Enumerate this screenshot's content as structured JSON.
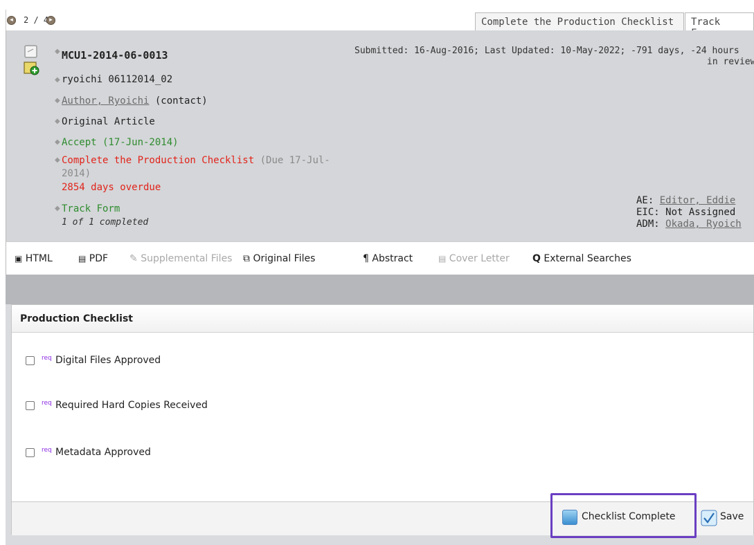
{
  "nav": {
    "pager_text": "2 / 4"
  },
  "tabs": [
    {
      "label": "Complete the Production Checklist"
    },
    {
      "label": "Track Form"
    }
  ],
  "manuscript": {
    "id": "MCU1-2014-06-0013",
    "title": "ryoichi 06112014_02",
    "author": "Author, Ryoichi",
    "author_suffix": "(contact)",
    "type": "Original Article",
    "decision": "Accept (17-Jun-2014)",
    "task": "Complete the Production Checklist",
    "task_due_1": "(Due 17-Jul-",
    "task_due_2": "2014)",
    "overdue": "2854 days overdue",
    "track_form": "Track Form",
    "track_form_status": "1 of 1 completed",
    "submitted_line1": "Submitted: 16-Aug-2016; Last Updated: 10-May-2022; -791 days, -24 hours",
    "submitted_line2": "in review"
  },
  "assignments": {
    "ae_label": "AE:",
    "ae_name": "Editor, Eddie",
    "eic": "EIC: Not Assigned",
    "adm_label": "ADM:",
    "adm_name": "Okada, Ryoich"
  },
  "toolbar": {
    "html": "HTML",
    "pdf": "PDF",
    "supplemental": "Supplemental Files",
    "original": "Original Files",
    "abstract": "Abstract",
    "cover_letter": "Cover Letter",
    "external": "External Searches"
  },
  "checklist": {
    "title": "Production Checklist",
    "req_tag": "req",
    "items": [
      {
        "label": "Digital Files Approved",
        "checked": false
      },
      {
        "label": "Required Hard Copies Received",
        "checked": false
      },
      {
        "label": "Metadata Approved",
        "checked": false
      }
    ],
    "complete_button": "Checklist Complete",
    "save_button": "Save"
  },
  "colors": {
    "header_bg": "#d4d6d9",
    "highlight": "#6a3ec2",
    "green": "#2e8b2e",
    "red": "#e2231a"
  },
  "icons": [
    "prev-icon",
    "next-icon",
    "document-icon",
    "add-note-icon",
    "html-icon",
    "pdf-icon",
    "paperclip-icon",
    "original-files-icon",
    "pilcrow-icon",
    "cover-letter-icon",
    "search-icon",
    "checklist-complete-icon",
    "save-icon"
  ]
}
